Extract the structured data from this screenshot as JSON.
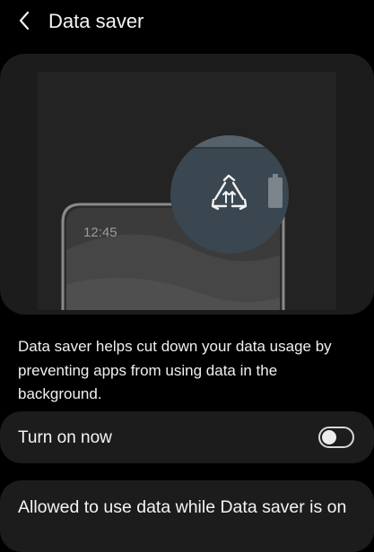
{
  "header": {
    "back_icon": "back-arrow-icon",
    "title": "Data saver"
  },
  "illustration": {
    "clock_time": "12:45",
    "icons": [
      "data-saver-icon",
      "battery-icon"
    ]
  },
  "description": "Data saver helps cut down your data usage by preventing apps from using data in the background.",
  "turn_on_now": {
    "label": "Turn on now",
    "enabled": false
  },
  "allowed_apps": {
    "label": "Allowed to use data while Data saver is on"
  },
  "colors": {
    "background": "#000000",
    "card": "#1c1c1c",
    "text": "#f4f4f4",
    "lens": "#3a4650"
  }
}
